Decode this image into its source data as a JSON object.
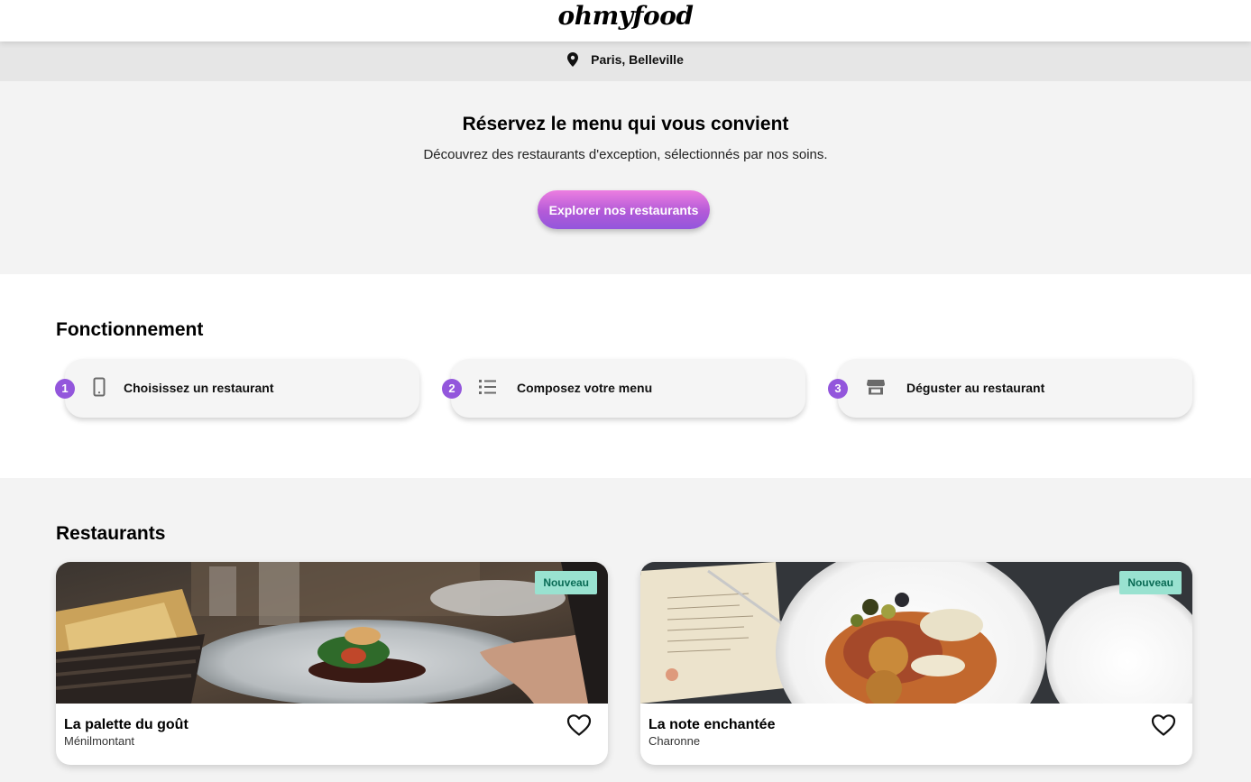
{
  "header": {
    "logo": "ohmyfood"
  },
  "location": {
    "icon": "map-pin-icon",
    "label": "Paris, Belleville"
  },
  "hero": {
    "title": "Réservez le menu qui vous convient",
    "subtitle": "Découvrez des restaurants d'exception, sélectionnés par nos soins.",
    "cta_label": "Explorer nos restaurants"
  },
  "how": {
    "title": "Fonctionnement",
    "steps": [
      {
        "number": "1",
        "icon": "smartphone-icon",
        "label": "Choisissez un restaurant"
      },
      {
        "number": "2",
        "icon": "list-icon",
        "label": "Composez votre menu"
      },
      {
        "number": "3",
        "icon": "store-icon",
        "label": "Déguster au restaurant"
      }
    ]
  },
  "restaurants": {
    "title": "Restaurants",
    "items": [
      {
        "name": "La palette du goût",
        "area": "Ménilmontant",
        "badge": "Nouveau",
        "favorite_icon": "heart-icon"
      },
      {
        "name": "La note enchantée",
        "area": "Charonne",
        "badge": "Nouveau",
        "favorite_icon": "heart-icon"
      }
    ]
  },
  "colors": {
    "accent": "#9356dc",
    "accent_light": "#ec7ee0",
    "badge_bg": "#99e2d0",
    "badge_text": "#0a6b55"
  }
}
